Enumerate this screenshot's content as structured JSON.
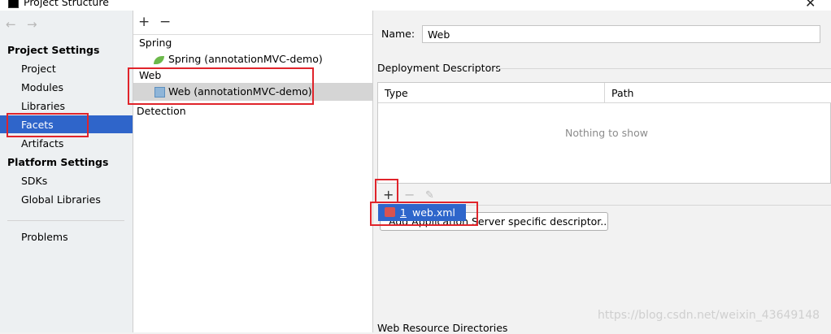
{
  "window": {
    "title": "Project Structure"
  },
  "nav": {
    "back_icon": "←",
    "forward_icon": "→",
    "project_settings_header": "Project Settings",
    "project_items": [
      "Project",
      "Modules",
      "Libraries",
      "Facets",
      "Artifacts"
    ],
    "selected": "Facets",
    "platform_settings_header": "Platform Settings",
    "platform_items": [
      "SDKs",
      "Global Libraries"
    ],
    "problems": "Problems"
  },
  "tree": {
    "add": "+",
    "remove": "−",
    "spring_group": "Spring",
    "spring_item": "Spring (annotationMVC-demo)",
    "web_group": "Web",
    "web_item": "Web (annotationMVC-demo)",
    "detection": "Detection"
  },
  "details": {
    "name_label": "Name:",
    "name_value": "Web",
    "deployment_title": "Deployment Descriptors",
    "col_type": "Type",
    "col_path": "Path",
    "empty_text": "Nothing to show",
    "add_server_button": "Add Application Server specific descriptor...",
    "popup_item_index": "1",
    "popup_item_label": "web.xml",
    "web_resource_title": "Web Resource Directories"
  },
  "watermark": "https://blog.csdn.net/weixin_43649148",
  "colors": {
    "selection": "#2f65ca",
    "highlight": "#e0242b"
  }
}
